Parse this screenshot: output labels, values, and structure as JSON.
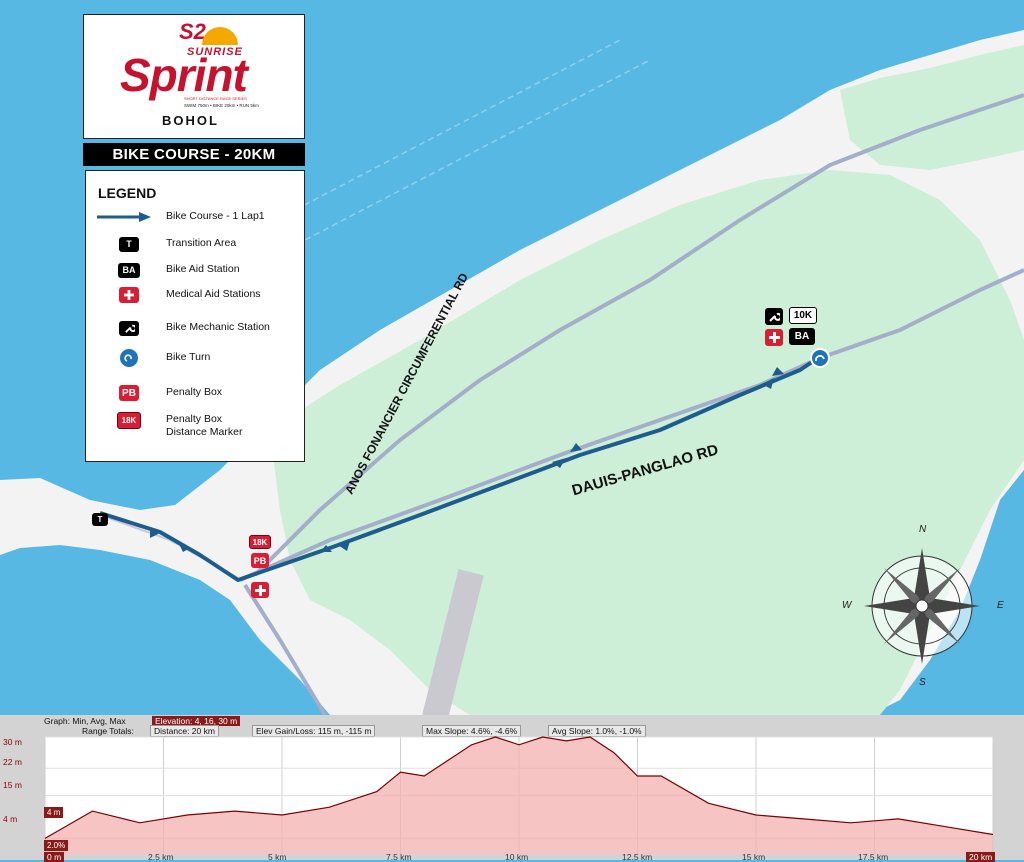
{
  "brand": {
    "logo_badge": "S2",
    "logo_word_top": "SUNRISE",
    "logo_word_main": "Sprint",
    "logo_tagline": "SHORT DISTANCE RACE SERIES",
    "logo_distances": "SWIM 750m • BIKE 20km • RUN 5km",
    "location": "BOHOL"
  },
  "course_title": "BIKE COURSE - 20KM",
  "legend": {
    "heading": "LEGEND",
    "items": [
      {
        "symbol": "arrow-line",
        "label": "Bike Course - 1 Lap1"
      },
      {
        "symbol": "T",
        "label": "Transition Area"
      },
      {
        "symbol": "BA",
        "label": "Bike Aid Station"
      },
      {
        "symbol": "medical-cross-icon",
        "label": "Medical Aid Stations"
      },
      {
        "symbol": "wrench-icon",
        "label": "Bike Mechanic Station"
      },
      {
        "symbol": "u-turn-icon",
        "label": "Bike Turn"
      },
      {
        "symbol": "PB",
        "label": "Penalty Box"
      },
      {
        "symbol": "18K",
        "label": "Penalty Box\nDistance Marker"
      }
    ]
  },
  "map": {
    "roads": [
      "ANOS FONANCIER CIRCUMFERENTIAL RD",
      "DAUIS-PANGLAO RD"
    ],
    "markers": {
      "transition": "T",
      "distance_turn": "10K",
      "aid_turn": "BA",
      "distance_penalty": "18K",
      "penalty": "PB"
    },
    "compass": {
      "n": "N",
      "s": "S",
      "e": "E",
      "w": "W"
    },
    "colors": {
      "water": "#57b8e3",
      "land": "#f3f3f3",
      "green": "#cdeed7",
      "course": "#1d5c8c",
      "road": "#a3aec9",
      "marker_red": "#d81e34"
    }
  },
  "profile": {
    "graph_label": "Graph: Min, Avg, Max",
    "elevation": "Elevation: 4, 16, 30 m",
    "range_totals": "Range Totals:",
    "distance": "Distance: 20 km",
    "gain_loss": "Elev Gain/Loss: 115 m, -115 m",
    "max_slope": "Max Slope: 4.6%, -4.6%",
    "avg_slope": "Avg Slope: 1.0%, -1.0%",
    "y_ticks": [
      "30 m",
      "22 m",
      "15 m",
      "4 m"
    ],
    "x_ticks": [
      "0 m",
      "2.5 km",
      "5 km",
      "7.5 km",
      "10 km",
      "12.5 km",
      "15 km",
      "17.5 km",
      "20 km"
    ],
    "cursor_elev": "4 m",
    "cursor_slope": "2.0%"
  },
  "chart_data": {
    "type": "area",
    "xlabel": "",
    "ylabel": "",
    "xlim": [
      0,
      20
    ],
    "ylim": [
      0,
      30
    ],
    "x": [
      0,
      1,
      2,
      3,
      4,
      5,
      6,
      7,
      7.5,
      8,
      9,
      9.5,
      10,
      10.5,
      11,
      11.5,
      12,
      12.5,
      13,
      14,
      15,
      16,
      17,
      18,
      19,
      20
    ],
    "series": [
      {
        "values": [
          4,
          11,
          8,
          10,
          11,
          10,
          12,
          16,
          21,
          20,
          28,
          30,
          28,
          30,
          29,
          30,
          26,
          20,
          20,
          13,
          10,
          9,
          8,
          9,
          7,
          5
        ]
      }
    ]
  }
}
